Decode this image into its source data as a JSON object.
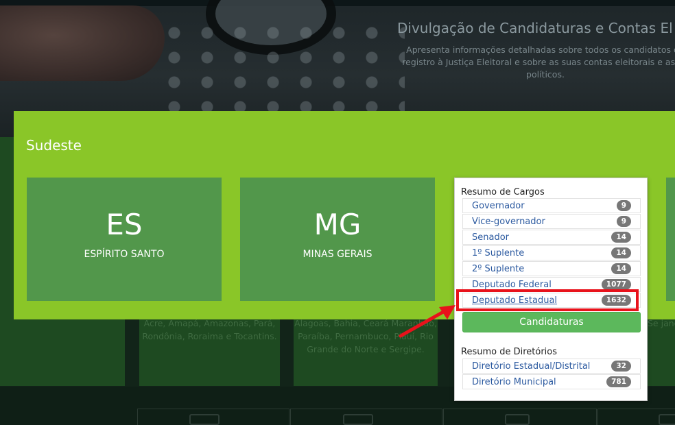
{
  "hero": {
    "title": "Divulgação de Candidaturas e Contas El",
    "subtitle": "Apresenta informações detalhadas sobre todos os candidatos qu registro à Justiça Eleitoral e sobre as suas contas eleitorais e as do políticos."
  },
  "background_tiles": [
    {
      "text": "Acre, Amapá, Amazonas, Pará, Rondônia, Roraima e Tocantins."
    },
    {
      "text": "Alagoas, Bahia, Ceará Maranhão, Paraíba, Pernambuco, Piauí, Rio Grande do Norte e Sergipe."
    },
    {
      "text": "Se janeir"
    }
  ],
  "region": {
    "name": "Sudeste",
    "states": [
      {
        "code": "ES",
        "name": "ESPÍRITO SANTO"
      },
      {
        "code": "MG",
        "name": "MINAS GERAIS"
      }
    ]
  },
  "panel": {
    "cargos_heading": "Resumo de Cargos",
    "cargos": [
      {
        "label": "Governador",
        "count": "9"
      },
      {
        "label": "Vice-governador",
        "count": "9"
      },
      {
        "label": "Senador",
        "count": "14"
      },
      {
        "label": "1º Suplente",
        "count": "14"
      },
      {
        "label": "2º Suplente",
        "count": "14"
      },
      {
        "label": "Deputado Federal",
        "count": "1077"
      },
      {
        "label": "Deputado Estadual",
        "count": "1632"
      }
    ],
    "candidaturas_button": "Candidaturas",
    "diretorios_heading": "Resumo de Diretórios",
    "diretorios": [
      {
        "label": "Diretório Estadual/Distrital",
        "count": "32"
      },
      {
        "label": "Diretório Municipal",
        "count": "781"
      }
    ]
  },
  "colors": {
    "overlay_green": "#8ac628",
    "state_tile_green": "#52974b",
    "button_green": "#5cb85c",
    "highlight_red": "#e8121b",
    "link_blue": "#2c5aa0",
    "badge_gray": "#777777"
  }
}
